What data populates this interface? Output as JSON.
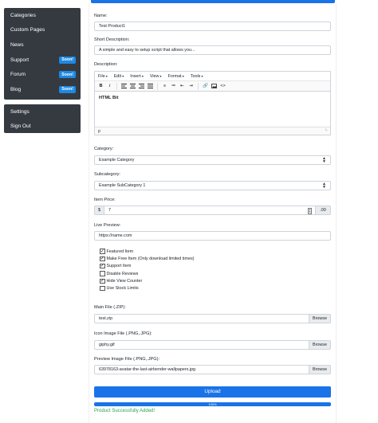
{
  "sidebar": {
    "items": [
      {
        "label": "Categories"
      },
      {
        "label": "Custom Pages"
      },
      {
        "label": "News"
      },
      {
        "label": "Support",
        "badge": "Soon!"
      },
      {
        "label": "Forum",
        "badge": "Soon!"
      },
      {
        "label": "Blog",
        "badge": "Soon!"
      }
    ],
    "bottom_items": [
      {
        "label": "Settings"
      },
      {
        "label": "Sign Out"
      }
    ]
  },
  "form": {
    "name": {
      "label": "Name:",
      "value": "Test Product1"
    },
    "short_description": {
      "label": "Short Description:",
      "value": "A simple and easy to setup script that allows you..."
    },
    "description": {
      "label": "Description:",
      "menus": [
        "File",
        "Edit",
        "Insert",
        "View",
        "Format",
        "Tools"
      ],
      "content": "HTML Bit",
      "status_path": "p"
    },
    "category": {
      "label": "Category:",
      "value": "Example Category"
    },
    "subcategory": {
      "label": "Subcategory:",
      "value": "Example SubCategory 1"
    },
    "price": {
      "label": "Item Price:",
      "prefix": "$",
      "value": "7",
      "suffix": ".00"
    },
    "live_preview": {
      "label": "Live Preview:",
      "value": "https://name.com"
    },
    "options": [
      {
        "label": "Featured Item",
        "checked": true
      },
      {
        "label": "Make Free Item (Only download limited times)",
        "checked": true
      },
      {
        "label": "Support Item",
        "checked": true
      },
      {
        "label": "Disable Reviews",
        "checked": false
      },
      {
        "label": "Hide View Counter",
        "checked": true
      },
      {
        "label": "Use Stock Limits",
        "checked": false
      }
    ],
    "main_file": {
      "label": "Main File (.ZIP):",
      "value": "test.zip",
      "button": "Browse"
    },
    "icon_file": {
      "label": "Icon Image File (.PNG,.JPG):",
      "value": "giphy.gif",
      "button": "Browse"
    },
    "preview_file": {
      "label": "Preview Image File (.PNG,.JPG):",
      "value": "63978163-avatar-the-last-airbender-wallpapers.jpg",
      "button": "Browse"
    },
    "upload_button": "Upload",
    "progress": {
      "percent": 100,
      "label": "100%"
    },
    "success_message": "Product Successfully Added!"
  },
  "colors": {
    "primary": "#1a73e8",
    "sidebar": "#343a40",
    "success": "#28a745"
  }
}
